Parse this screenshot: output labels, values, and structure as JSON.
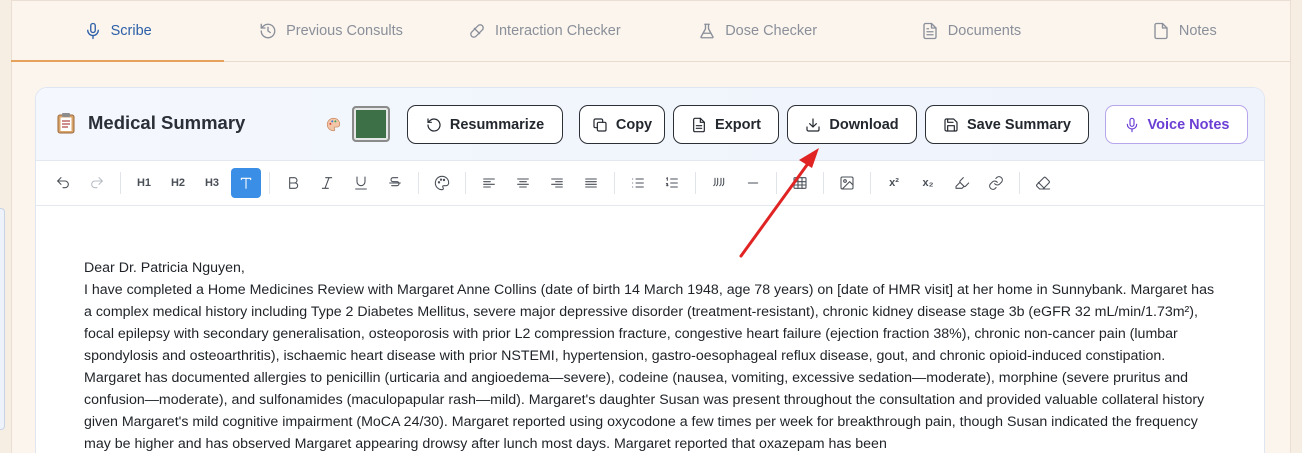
{
  "tabs": [
    {
      "label": "Scribe",
      "icon": "microphone-icon",
      "active": true
    },
    {
      "label": "Previous Consults",
      "icon": "history-icon"
    },
    {
      "label": "Interaction Checker",
      "icon": "pill-icon"
    },
    {
      "label": "Dose Checker",
      "icon": "flask-icon"
    },
    {
      "label": "Documents",
      "icon": "document-icon"
    },
    {
      "label": "Notes",
      "icon": "note-icon"
    }
  ],
  "card": {
    "title": "Medical Summary",
    "swatch_color": "#3e7048",
    "buttons": {
      "resummarize": "Resummarize",
      "copy": "Copy",
      "export": "Export",
      "download": "Download",
      "save_summary": "Save Summary",
      "voice_notes": "Voice Notes"
    }
  },
  "toolbar": {
    "h1": "H1",
    "h2": "H2",
    "h3": "H3",
    "superscript": "x²",
    "subscript": "x₂"
  },
  "document": {
    "salutation": "Dear Dr. Patricia Nguyen,",
    "body": "I have completed a Home Medicines Review with Margaret Anne Collins (date of birth 14 March 1948, age 78 years) on [date of HMR visit] at her home in Sunnybank. Margaret has a complex medical history including Type 2 Diabetes Mellitus, severe major depressive disorder (treatment-resistant), chronic kidney disease stage 3b (eGFR 32 mL/min/1.73m²), focal epilepsy with secondary generalisation, osteoporosis with prior L2 compression fracture, congestive heart failure (ejection fraction 38%), chronic non-cancer pain (lumbar spondylosis and osteoarthritis), ischaemic heart disease with prior NSTEMI, hypertension, gastro-oesophageal reflux disease, gout, and chronic opioid-induced constipation. Margaret has documented allergies to penicillin (urticaria and angioedema—severe), codeine (nausea, vomiting, excessive sedation—moderate), morphine (severe pruritus and confusion—moderate), and sulfonamides (maculopapular rash—mild). Margaret's daughter Susan was present throughout the consultation and provided valuable collateral history given Margaret's mild cognitive impairment (MoCA 24/30). Margaret reported using oxycodone a few times per week for breakthrough pain, though Susan indicated the frequency may be higher and has observed Margaret appearing drowsy after lunch most days. Margaret reported that oxazepam has been"
  },
  "colors": {
    "accent_tab": "#2d5fa7",
    "tab_underline": "#e6a25b",
    "voice": "#6b3fd4",
    "active_tool": "#3a8ee6",
    "annotation_arrow": "#e02424"
  }
}
